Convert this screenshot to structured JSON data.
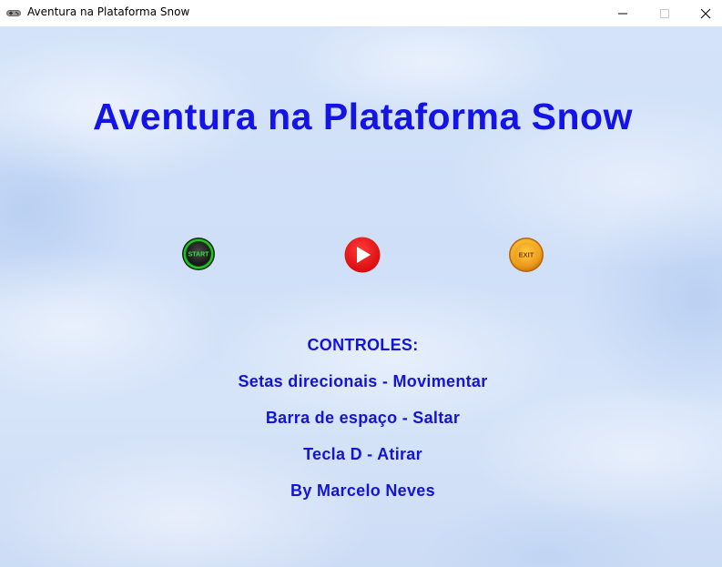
{
  "window": {
    "title": "Aventura na Plataforma Snow",
    "icon": "gamepad-icon",
    "controls": [
      "minimize-icon",
      "maximize-icon",
      "close-icon"
    ]
  },
  "game": {
    "title": "Aventura na Plataforma Snow",
    "title_color": "#1414e6",
    "buttons": {
      "start_label": "START",
      "play_icon": "play-icon",
      "exit_label": "EXIT"
    },
    "controls": {
      "heading": "CONTROLES:",
      "move": "Setas direcionais - Movimentar",
      "jump": "Barra de espaço - Saltar",
      "shoot": "Tecla D - Atirar",
      "credit": "By Marcelo Neves"
    },
    "colors": {
      "start_green": "#22c02a",
      "play_red": "#ee0f0f",
      "exit_gold": "#f0a21c"
    }
  }
}
